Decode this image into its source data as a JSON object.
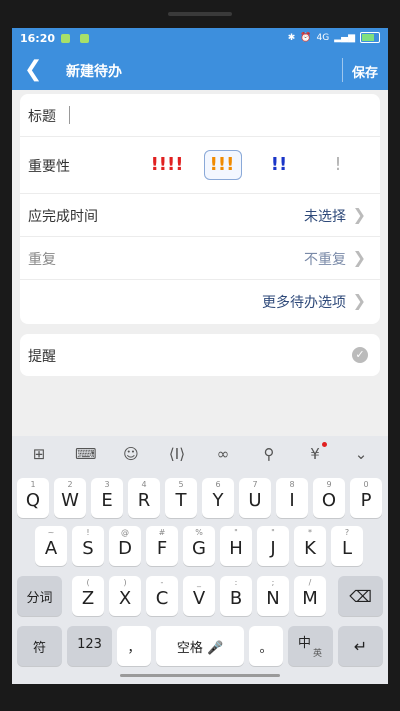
{
  "status": {
    "time": "16:20",
    "battery_label": "4G"
  },
  "header": {
    "back_icon": "back-chevron-icon",
    "title": "新建待办",
    "save_label": "保存"
  },
  "form": {
    "title_label": "标题",
    "importance_label": "重要性",
    "priorities": [
      {
        "label": "!!!!",
        "color": "#e02020"
      },
      {
        "label": "!!!",
        "color": "#f08a00"
      },
      {
        "label": "!!",
        "color": "#1a35c8"
      },
      {
        "label": "!",
        "color": "#b0b0b0"
      }
    ],
    "due_label": "应完成时间",
    "due_value": "未选择",
    "repeat_label": "重复",
    "repeat_value": "不重复",
    "more_options": "更多待办选项",
    "reminder_label": "提醒"
  },
  "keyboard": {
    "row1": [
      [
        "1",
        "Q"
      ],
      [
        "2",
        "W"
      ],
      [
        "3",
        "E"
      ],
      [
        "4",
        "R"
      ],
      [
        "5",
        "T"
      ],
      [
        "6",
        "Y"
      ],
      [
        "7",
        "U"
      ],
      [
        "8",
        "I"
      ],
      [
        "9",
        "O"
      ],
      [
        "0",
        "P"
      ]
    ],
    "row2": [
      [
        "~",
        "A"
      ],
      [
        "!",
        "S"
      ],
      [
        "@",
        "D"
      ],
      [
        "#",
        "F"
      ],
      [
        "%",
        "G"
      ],
      [
        "\"",
        "H"
      ],
      [
        "\"",
        "J"
      ],
      [
        "*",
        "K"
      ],
      [
        "?",
        "L"
      ]
    ],
    "row3": [
      [
        "(",
        "Z"
      ],
      [
        ")",
        "X"
      ],
      [
        "-",
        "C"
      ],
      [
        "_",
        "V"
      ],
      [
        ":",
        "B"
      ],
      [
        ";",
        "N"
      ],
      [
        "/",
        "M"
      ]
    ],
    "fenci": "分词",
    "fu": "符",
    "num": "123",
    "comma": "，",
    "space": "空格",
    "period": "。",
    "lang_main": "中",
    "lang_sub": "英",
    "enter": "↵",
    "backspace": "⌫"
  }
}
